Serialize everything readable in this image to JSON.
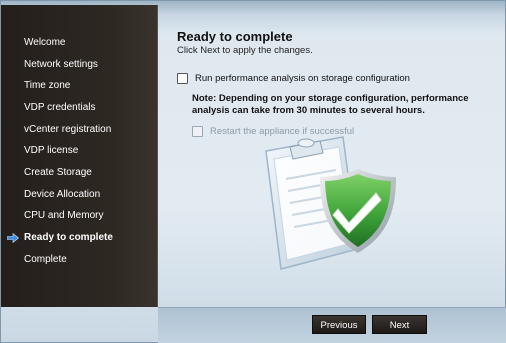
{
  "sidebar": {
    "items": [
      {
        "label": "Welcome"
      },
      {
        "label": "Network settings"
      },
      {
        "label": "Time zone"
      },
      {
        "label": "VDP credentials"
      },
      {
        "label": "vCenter registration"
      },
      {
        "label": "VDP license"
      },
      {
        "label": "Create Storage"
      },
      {
        "label": "Device Allocation"
      },
      {
        "label": "CPU and Memory"
      },
      {
        "label": "Ready to complete",
        "active": true
      },
      {
        "label": "Complete"
      }
    ],
    "active_icon": "arrow-right-icon"
  },
  "main": {
    "title": "Ready to complete",
    "subtitle": "Click Next to apply the changes.",
    "perf_checkbox": {
      "label": "Run performance analysis on storage configuration",
      "checked": false
    },
    "note": "Note: Depending on your storage configuration, performance analysis can take from 30 minutes to several hours.",
    "restart_checkbox": {
      "label": "Restart the appliance if successful",
      "checked": false,
      "disabled": true
    },
    "illustration_icon": "clipboard-shield-check-icon"
  },
  "footer": {
    "previous_label": "Previous",
    "next_label": "Next"
  },
  "colors": {
    "sidebar_bg": "#2a2420",
    "accent_arrow": "#3f8fe0",
    "shield_green": "#3fa43a"
  }
}
